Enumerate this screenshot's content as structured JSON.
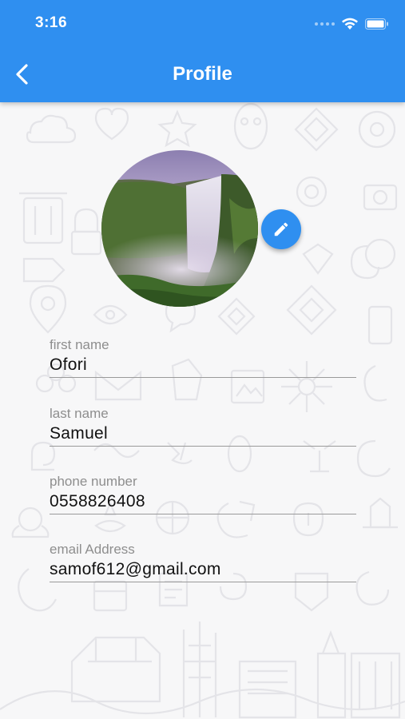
{
  "status_bar": {
    "time": "3:16"
  },
  "header": {
    "title": "Profile"
  },
  "profile": {
    "fields": [
      {
        "label": "first name",
        "value": "Ofori"
      },
      {
        "label": "last name",
        "value": "Samuel"
      },
      {
        "label": "phone number",
        "value": "0558826408"
      },
      {
        "label": "email Address",
        "value": "samof612@gmail.com"
      }
    ]
  },
  "colors": {
    "primary": "#2f8ff0",
    "background": "#f7f7f8",
    "label": "#8e8e8e",
    "value": "#111111"
  },
  "icons": [
    "back-chevron-icon",
    "wifi-icon",
    "battery-icon",
    "pencil-icon"
  ]
}
